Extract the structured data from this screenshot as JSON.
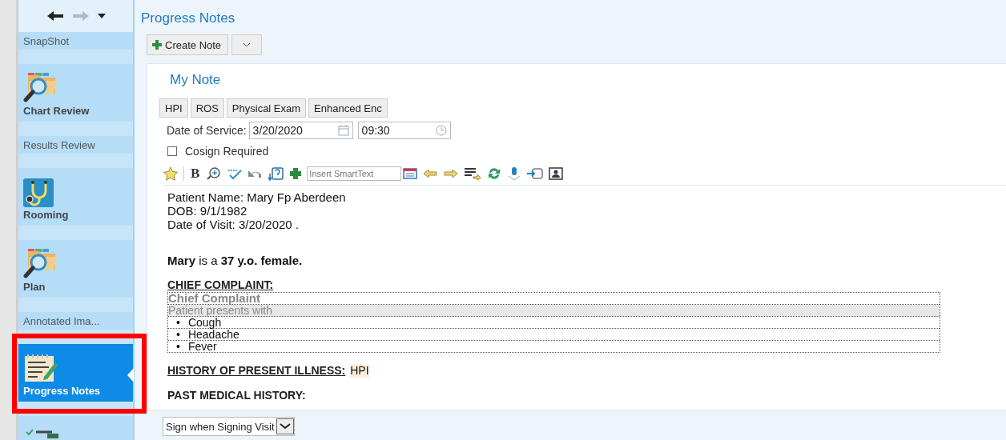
{
  "sidebar": {
    "items": [
      {
        "label": "SnapShot",
        "kind": "small",
        "selected": false
      },
      {
        "label": "Chart Review",
        "kind": "large",
        "selected": false
      },
      {
        "label": "Results Review",
        "kind": "small",
        "selected": false
      },
      {
        "label": "Rooming",
        "kind": "large",
        "selected": false
      },
      {
        "label": "Plan",
        "kind": "large",
        "selected": false
      },
      {
        "label": "Annotated Ima...",
        "kind": "small",
        "selected": false
      },
      {
        "label": "Progress Notes",
        "kind": "large",
        "selected": true,
        "highlighted": true
      },
      {
        "kind": "partial"
      }
    ]
  },
  "page": {
    "title": "Progress Notes",
    "create_button": "Create Note"
  },
  "note": {
    "title": "My Note",
    "tabs": [
      "HPI",
      "ROS",
      "Physical Exam",
      "Enhanced Enc"
    ],
    "date_label": "Date of Service:",
    "date": "3/20/2020",
    "time": "09:30",
    "cosign": {
      "label": "Cosign Required",
      "checked": false
    },
    "toolbar": {
      "bold": "B",
      "smarttext_placeholder": "Insert SmartText"
    },
    "body": [
      {
        "kind": "line",
        "text": "Patient Name: Mary Fp Aberdeen"
      },
      {
        "kind": "line",
        "text": "DOB: 9/1/1982"
      },
      {
        "kind": "line",
        "text": "Date of Visit: 3/20/2020 ."
      },
      {
        "kind": "gap"
      },
      {
        "kind": "line",
        "text": "**Mary** is a **37 y.o. female.**"
      },
      {
        "kind": "heading",
        "text": "CHIEF COMPLAINT:"
      },
      {
        "kind": "box",
        "title": "Chief Complaint",
        "intro": "Patient presents with",
        "bullet": "•",
        "items": [
          "Cough",
          "Headache",
          "Fever"
        ]
      },
      {
        "kind": "heading",
        "text": "HISTORY OF PRESENT ILLNESS:",
        "tag": "HPI"
      },
      {
        "kind": "heading",
        "text": "PAST MEDICAL HISTORY:",
        "underline": false
      }
    ]
  },
  "footer": {
    "sign_option": "Sign when Signing Visit"
  }
}
